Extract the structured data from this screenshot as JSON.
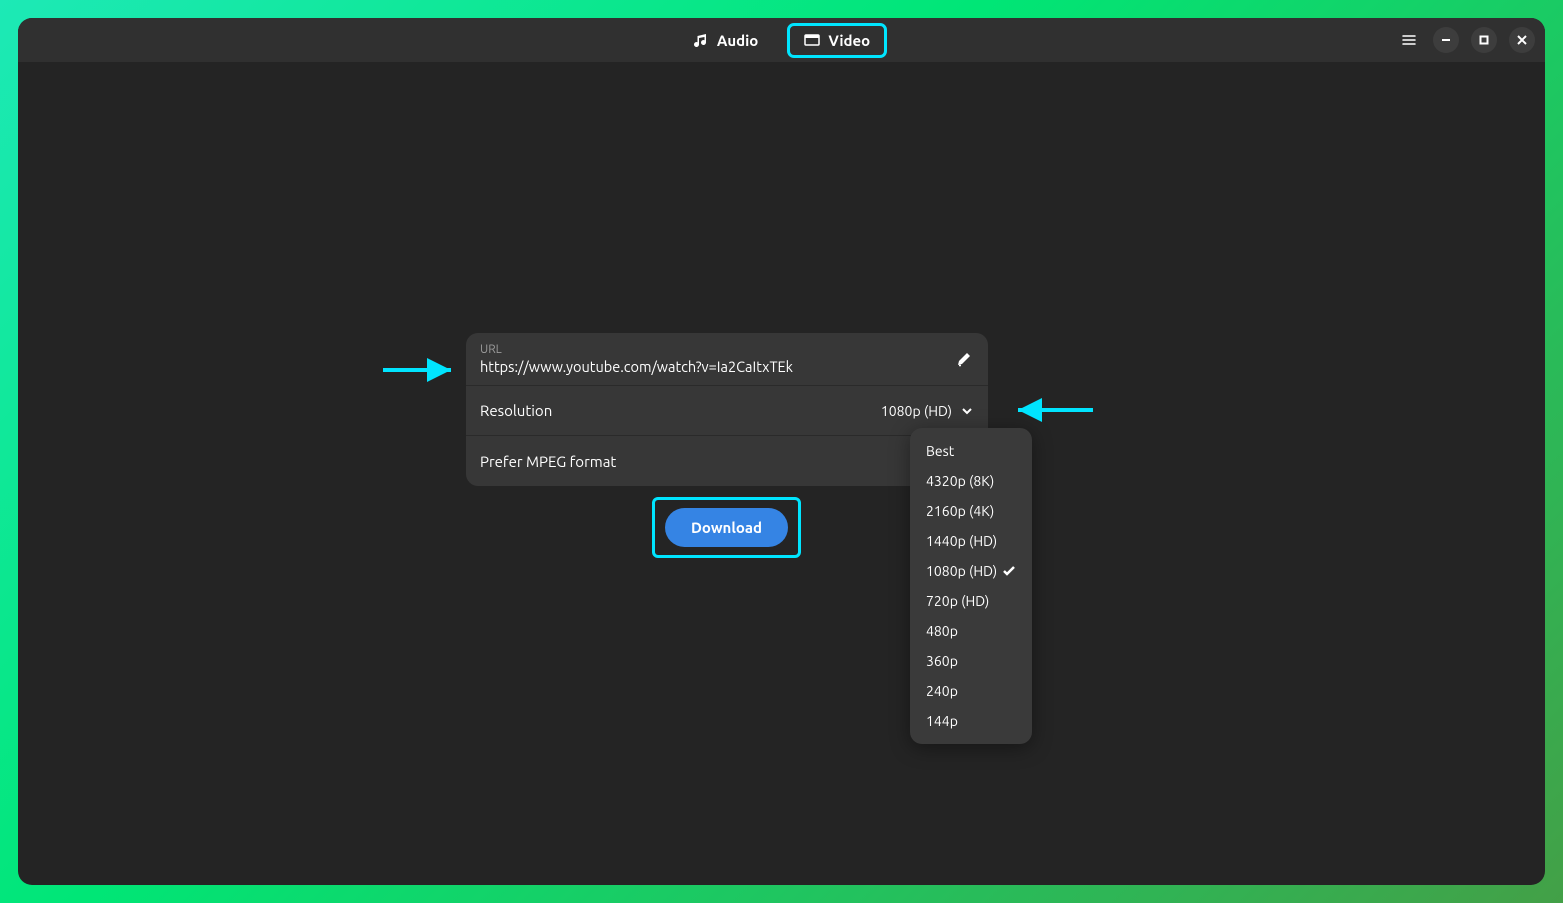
{
  "tabs": {
    "audio": "Audio",
    "video": "Video"
  },
  "url_section": {
    "label": "URL",
    "value": "https://www.youtube.com/watch?v=Ia2CaItxTEk"
  },
  "resolution_section": {
    "label": "Resolution",
    "selected": "1080p (HD)"
  },
  "mpeg_section": {
    "label": "Prefer MPEG format",
    "enabled": false
  },
  "download_button": "Download",
  "resolution_options": [
    {
      "label": "Best",
      "selected": false
    },
    {
      "label": "4320p (8K)",
      "selected": false
    },
    {
      "label": "2160p (4K)",
      "selected": false
    },
    {
      "label": "1440p (HD)",
      "selected": false
    },
    {
      "label": "1080p (HD)",
      "selected": true
    },
    {
      "label": "720p (HD)",
      "selected": false
    },
    {
      "label": "480p",
      "selected": false
    },
    {
      "label": "360p",
      "selected": false
    },
    {
      "label": "240p",
      "selected": false
    },
    {
      "label": "144p",
      "selected": false
    }
  ],
  "colors": {
    "highlight": "#00e5ff",
    "button_primary": "#3584e4"
  }
}
